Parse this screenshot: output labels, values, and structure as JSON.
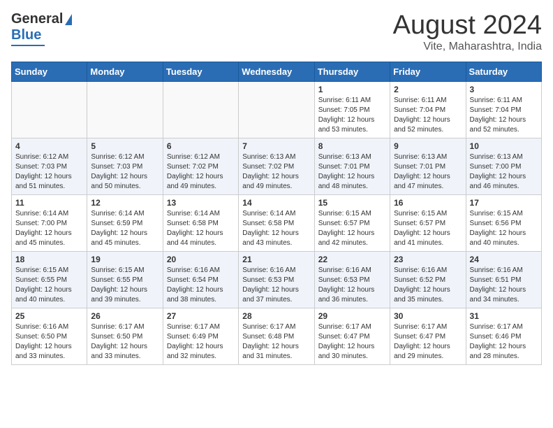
{
  "header": {
    "logo_general": "General",
    "logo_blue": "Blue",
    "title": "August 2024",
    "subtitle": "Vite, Maharashtra, India"
  },
  "days_of_week": [
    "Sunday",
    "Monday",
    "Tuesday",
    "Wednesday",
    "Thursday",
    "Friday",
    "Saturday"
  ],
  "weeks": [
    [
      {
        "day": "",
        "content": ""
      },
      {
        "day": "",
        "content": ""
      },
      {
        "day": "",
        "content": ""
      },
      {
        "day": "",
        "content": ""
      },
      {
        "day": "1",
        "sunrise": "Sunrise: 6:11 AM",
        "sunset": "Sunset: 7:05 PM",
        "daylight": "Daylight: 12 hours and 53 minutes."
      },
      {
        "day": "2",
        "sunrise": "Sunrise: 6:11 AM",
        "sunset": "Sunset: 7:04 PM",
        "daylight": "Daylight: 12 hours and 52 minutes."
      },
      {
        "day": "3",
        "sunrise": "Sunrise: 6:11 AM",
        "sunset": "Sunset: 7:04 PM",
        "daylight": "Daylight: 12 hours and 52 minutes."
      }
    ],
    [
      {
        "day": "4",
        "sunrise": "Sunrise: 6:12 AM",
        "sunset": "Sunset: 7:03 PM",
        "daylight": "Daylight: 12 hours and 51 minutes."
      },
      {
        "day": "5",
        "sunrise": "Sunrise: 6:12 AM",
        "sunset": "Sunset: 7:03 PM",
        "daylight": "Daylight: 12 hours and 50 minutes."
      },
      {
        "day": "6",
        "sunrise": "Sunrise: 6:12 AM",
        "sunset": "Sunset: 7:02 PM",
        "daylight": "Daylight: 12 hours and 49 minutes."
      },
      {
        "day": "7",
        "sunrise": "Sunrise: 6:13 AM",
        "sunset": "Sunset: 7:02 PM",
        "daylight": "Daylight: 12 hours and 49 minutes."
      },
      {
        "day": "8",
        "sunrise": "Sunrise: 6:13 AM",
        "sunset": "Sunset: 7:01 PM",
        "daylight": "Daylight: 12 hours and 48 minutes."
      },
      {
        "day": "9",
        "sunrise": "Sunrise: 6:13 AM",
        "sunset": "Sunset: 7:01 PM",
        "daylight": "Daylight: 12 hours and 47 minutes."
      },
      {
        "day": "10",
        "sunrise": "Sunrise: 6:13 AM",
        "sunset": "Sunset: 7:00 PM",
        "daylight": "Daylight: 12 hours and 46 minutes."
      }
    ],
    [
      {
        "day": "11",
        "sunrise": "Sunrise: 6:14 AM",
        "sunset": "Sunset: 7:00 PM",
        "daylight": "Daylight: 12 hours and 45 minutes."
      },
      {
        "day": "12",
        "sunrise": "Sunrise: 6:14 AM",
        "sunset": "Sunset: 6:59 PM",
        "daylight": "Daylight: 12 hours and 45 minutes."
      },
      {
        "day": "13",
        "sunrise": "Sunrise: 6:14 AM",
        "sunset": "Sunset: 6:58 PM",
        "daylight": "Daylight: 12 hours and 44 minutes."
      },
      {
        "day": "14",
        "sunrise": "Sunrise: 6:14 AM",
        "sunset": "Sunset: 6:58 PM",
        "daylight": "Daylight: 12 hours and 43 minutes."
      },
      {
        "day": "15",
        "sunrise": "Sunrise: 6:15 AM",
        "sunset": "Sunset: 6:57 PM",
        "daylight": "Daylight: 12 hours and 42 minutes."
      },
      {
        "day": "16",
        "sunrise": "Sunrise: 6:15 AM",
        "sunset": "Sunset: 6:57 PM",
        "daylight": "Daylight: 12 hours and 41 minutes."
      },
      {
        "day": "17",
        "sunrise": "Sunrise: 6:15 AM",
        "sunset": "Sunset: 6:56 PM",
        "daylight": "Daylight: 12 hours and 40 minutes."
      }
    ],
    [
      {
        "day": "18",
        "sunrise": "Sunrise: 6:15 AM",
        "sunset": "Sunset: 6:55 PM",
        "daylight": "Daylight: 12 hours and 40 minutes."
      },
      {
        "day": "19",
        "sunrise": "Sunrise: 6:15 AM",
        "sunset": "Sunset: 6:55 PM",
        "daylight": "Daylight: 12 hours and 39 minutes."
      },
      {
        "day": "20",
        "sunrise": "Sunrise: 6:16 AM",
        "sunset": "Sunset: 6:54 PM",
        "daylight": "Daylight: 12 hours and 38 minutes."
      },
      {
        "day": "21",
        "sunrise": "Sunrise: 6:16 AM",
        "sunset": "Sunset: 6:53 PM",
        "daylight": "Daylight: 12 hours and 37 minutes."
      },
      {
        "day": "22",
        "sunrise": "Sunrise: 6:16 AM",
        "sunset": "Sunset: 6:53 PM",
        "daylight": "Daylight: 12 hours and 36 minutes."
      },
      {
        "day": "23",
        "sunrise": "Sunrise: 6:16 AM",
        "sunset": "Sunset: 6:52 PM",
        "daylight": "Daylight: 12 hours and 35 minutes."
      },
      {
        "day": "24",
        "sunrise": "Sunrise: 6:16 AM",
        "sunset": "Sunset: 6:51 PM",
        "daylight": "Daylight: 12 hours and 34 minutes."
      }
    ],
    [
      {
        "day": "25",
        "sunrise": "Sunrise: 6:16 AM",
        "sunset": "Sunset: 6:50 PM",
        "daylight": "Daylight: 12 hours and 33 minutes."
      },
      {
        "day": "26",
        "sunrise": "Sunrise: 6:17 AM",
        "sunset": "Sunset: 6:50 PM",
        "daylight": "Daylight: 12 hours and 33 minutes."
      },
      {
        "day": "27",
        "sunrise": "Sunrise: 6:17 AM",
        "sunset": "Sunset: 6:49 PM",
        "daylight": "Daylight: 12 hours and 32 minutes."
      },
      {
        "day": "28",
        "sunrise": "Sunrise: 6:17 AM",
        "sunset": "Sunset: 6:48 PM",
        "daylight": "Daylight: 12 hours and 31 minutes."
      },
      {
        "day": "29",
        "sunrise": "Sunrise: 6:17 AM",
        "sunset": "Sunset: 6:47 PM",
        "daylight": "Daylight: 12 hours and 30 minutes."
      },
      {
        "day": "30",
        "sunrise": "Sunrise: 6:17 AM",
        "sunset": "Sunset: 6:47 PM",
        "daylight": "Daylight: 12 hours and 29 minutes."
      },
      {
        "day": "31",
        "sunrise": "Sunrise: 6:17 AM",
        "sunset": "Sunset: 6:46 PM",
        "daylight": "Daylight: 12 hours and 28 minutes."
      }
    ]
  ]
}
